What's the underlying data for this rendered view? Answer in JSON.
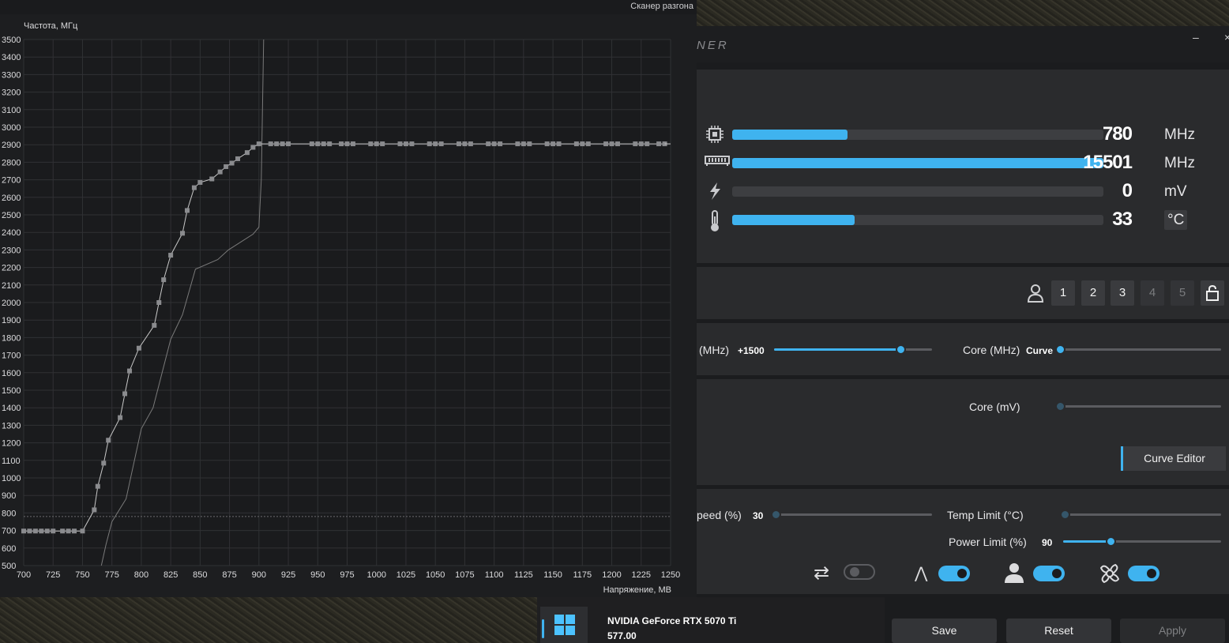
{
  "scanner": {
    "title": "Сканер разгона",
    "y_label": "Частота, МГц",
    "x_label": "Напряжение, МВ"
  },
  "chart_data": {
    "type": "line",
    "xlabel": "Напряжение, МВ",
    "ylabel": "Частота, МГц",
    "xlim": [
      700,
      1250
    ],
    "ylim": [
      500,
      3500
    ],
    "x_ticks": [
      700,
      725,
      750,
      775,
      800,
      825,
      850,
      875,
      900,
      925,
      950,
      975,
      1000,
      1025,
      1050,
      1075,
      1100,
      1125,
      1150,
      1175,
      1200,
      1225,
      1250
    ],
    "y_ticks": [
      500,
      600,
      700,
      800,
      900,
      1000,
      1100,
      1200,
      1300,
      1400,
      1500,
      1600,
      1700,
      1800,
      1900,
      2000,
      2100,
      2200,
      2300,
      2400,
      2500,
      2600,
      2700,
      2800,
      2900,
      3000,
      3100,
      3200,
      3300,
      3400,
      3500
    ],
    "grid": true,
    "reference_line_y": 780,
    "series": [
      {
        "points": [
          [
            700,
            697
          ],
          [
            705,
            697
          ],
          [
            710,
            697
          ],
          [
            715,
            697
          ],
          [
            720,
            697
          ],
          [
            725,
            697
          ],
          [
            733,
            697
          ],
          [
            738,
            697
          ],
          [
            743,
            697
          ],
          [
            750,
            697
          ],
          [
            760,
            818
          ],
          [
            763,
            952
          ],
          [
            768,
            1084
          ],
          [
            772,
            1215
          ],
          [
            782,
            1344
          ],
          [
            786,
            1480
          ],
          [
            790,
            1610
          ],
          [
            798,
            1740
          ],
          [
            811,
            1870
          ],
          [
            815,
            2000
          ],
          [
            819,
            2130
          ],
          [
            825,
            2270
          ],
          [
            835,
            2395
          ],
          [
            839,
            2525
          ],
          [
            845,
            2655
          ],
          [
            850,
            2685
          ],
          [
            860,
            2705
          ],
          [
            867,
            2745
          ],
          [
            872,
            2775
          ],
          [
            877,
            2795
          ],
          [
            882,
            2820
          ],
          [
            890,
            2855
          ],
          [
            895,
            2885
          ],
          [
            900,
            2905
          ],
          [
            910,
            2905
          ],
          [
            915,
            2905
          ],
          [
            920,
            2905
          ],
          [
            925,
            2905
          ],
          [
            945,
            2905
          ],
          [
            950,
            2905
          ],
          [
            955,
            2905
          ],
          [
            960,
            2905
          ],
          [
            970,
            2905
          ],
          [
            975,
            2905
          ],
          [
            980,
            2905
          ],
          [
            995,
            2905
          ],
          [
            1000,
            2905
          ],
          [
            1005,
            2905
          ],
          [
            1020,
            2905
          ],
          [
            1025,
            2905
          ],
          [
            1030,
            2905
          ],
          [
            1045,
            2905
          ],
          [
            1050,
            2905
          ],
          [
            1055,
            2905
          ],
          [
            1070,
            2905
          ],
          [
            1075,
            2905
          ],
          [
            1080,
            2905
          ],
          [
            1095,
            2905
          ],
          [
            1100,
            2905
          ],
          [
            1105,
            2905
          ],
          [
            1120,
            2905
          ],
          [
            1125,
            2905
          ],
          [
            1130,
            2905
          ],
          [
            1145,
            2905
          ],
          [
            1150,
            2905
          ],
          [
            1155,
            2905
          ],
          [
            1170,
            2905
          ],
          [
            1175,
            2905
          ],
          [
            1180,
            2905
          ],
          [
            1195,
            2905
          ],
          [
            1200,
            2905
          ],
          [
            1205,
            2905
          ],
          [
            1220,
            2905
          ],
          [
            1225,
            2905
          ],
          [
            1230,
            2905
          ],
          [
            1240,
            2905
          ],
          [
            1245,
            2905
          ]
        ],
        "color": "#c8c8c8",
        "markers": true
      },
      {
        "points": [
          [
            766,
            500
          ],
          [
            770,
            620
          ],
          [
            775,
            750
          ],
          [
            787,
            880
          ],
          [
            800,
            1280
          ],
          [
            810,
            1400
          ],
          [
            825,
            1790
          ],
          [
            835,
            1930
          ],
          [
            846,
            2190
          ],
          [
            865,
            2245
          ],
          [
            874,
            2300
          ],
          [
            895,
            2390
          ],
          [
            900,
            2430
          ],
          [
            902,
            2700
          ],
          [
            904,
            3500
          ]
        ],
        "color": "#7a7a7a",
        "markers": false
      }
    ]
  },
  "afterburner": {
    "brand": "NER",
    "minimize": "–",
    "close": "×",
    "monitor": [
      {
        "icon": "chip-icon",
        "value": "780",
        "unit": "MHz",
        "fill": 0.31
      },
      {
        "icon": "memory-icon",
        "value": "15501",
        "unit": "MHz",
        "fill": 1.0
      },
      {
        "icon": "voltage-icon",
        "value": "0",
        "unit": "mV",
        "fill": 0
      },
      {
        "icon": "thermometer-icon",
        "value": "33",
        "unit": "°C",
        "fill": 0.33
      }
    ],
    "profiles": [
      "1",
      "2",
      "3",
      "4",
      "5"
    ],
    "memory_clock": {
      "label": "(MHz)",
      "value": "+1500",
      "fill": 0.8
    },
    "core_clock": {
      "label": "Core (MHz)",
      "value": "Curve"
    },
    "core_voltage": {
      "label": "Core (mV)"
    },
    "curve_editor": "Curve Editor",
    "fan_speed": {
      "label": "peed (%)",
      "value": "30"
    },
    "temp_limit": {
      "label": "Temp Limit (°C)"
    },
    "power_limit": {
      "label": "Power Limit (%)",
      "value": "90",
      "fill": 0.3
    },
    "buttons": {
      "save": "Save",
      "reset": "Reset",
      "apply": "Apply"
    }
  },
  "taskbar": {
    "gpu_name": "NVIDIA GeForce RTX 5070 Ti",
    "driver_version": "577.00"
  }
}
